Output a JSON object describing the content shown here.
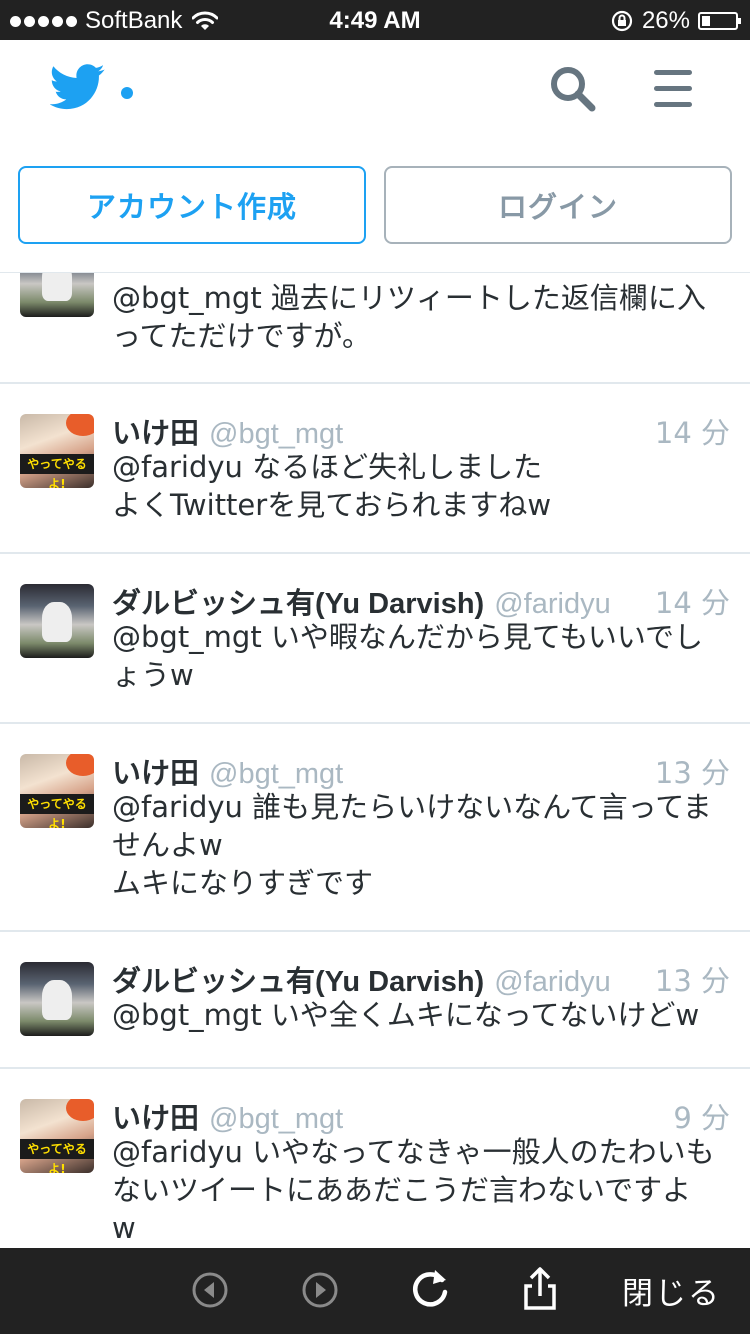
{
  "status_bar": {
    "carrier": "SoftBank",
    "time": "4:49 AM",
    "battery_text": "26%",
    "battery_level": 0.26
  },
  "header": {
    "logo_icon": "twitter-bird-icon",
    "search_icon": "search-icon",
    "menu_icon": "hamburger-menu-icon",
    "signup_label": "アカウント作成",
    "login_label": "ログイン"
  },
  "timeline": {
    "tweets": [
      {
        "avatar": "darvish",
        "name": "",
        "handle": "",
        "time": "",
        "lines": [
          "@bgt_mgt 過去にリツィートした返信欄に入",
          "ってただけですが。"
        ]
      },
      {
        "avatar": "ikeda",
        "name": "いけ田",
        "handle": "@bgt_mgt",
        "time": "14 分",
        "lines": [
          "@faridyu なるほど失礼しました",
          "よくTwitterを見ておられますねw"
        ]
      },
      {
        "avatar": "darvish",
        "name": "ダルビッシュ有(Yu Darvish)",
        "handle": "@faridyu",
        "time": "14 分",
        "lines": [
          "@bgt_mgt いや暇なんだから見てもいいでし",
          "ょうw"
        ]
      },
      {
        "avatar": "ikeda",
        "name": "いけ田",
        "handle": "@bgt_mgt",
        "time": "13 分",
        "lines": [
          "@faridyu 誰も見たらいけないなんて言ってま",
          "せんよw",
          "ムキになりすぎです"
        ]
      },
      {
        "avatar": "darvish",
        "name": "ダルビッシュ有(Yu Darvish)",
        "handle": "@faridyu",
        "time": "13 分",
        "lines": [
          "@bgt_mgt いや全くムキになってないけどw"
        ]
      },
      {
        "avatar": "ikeda",
        "name": "いけ田",
        "handle": "@bgt_mgt",
        "time": "9 分",
        "lines": [
          "@faridyu いやなってなきゃ一般人のたわいも",
          "ないツイートにああだこうだ言わないですよ",
          "w"
        ]
      }
    ]
  },
  "toolbar": {
    "back_icon": "back-arrow-icon",
    "forward_icon": "forward-arrow-icon",
    "reload_icon": "reload-icon",
    "share_icon": "share-icon",
    "close_label": "閉じる"
  },
  "colors": {
    "twitter_blue": "#1da1f2",
    "muted_gray": "#aab8c2",
    "bar_dark": "#222222"
  }
}
